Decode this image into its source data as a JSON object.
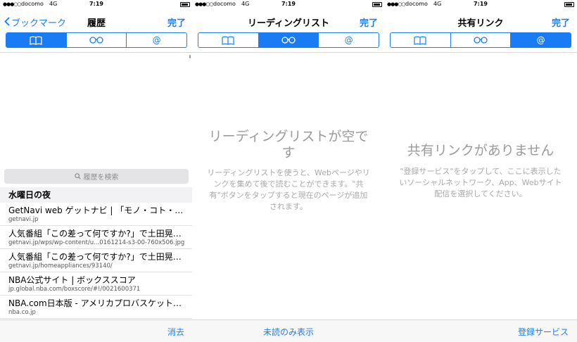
{
  "status_bar": {
    "signal": "●●●○○",
    "carrier": "docomo",
    "network": "4G",
    "time": "7:19"
  },
  "history_panel": {
    "back_label": "ブックマーク",
    "title": "履歴",
    "done_label": "完了",
    "search_placeholder": "履歴を検索",
    "section_header": "水曜日の夜",
    "items": [
      {
        "title": "GetNavi web ゲットナビ | 「モノ・コト・暮らし」の",
        "url": "getnavi.jp"
      },
      {
        "title": "人気番組「この差って何ですか?」で土田晃之が...",
        "url": "getnavi.jp/wps/wp-content/u...0161214-s3-00-760x506.jpg"
      },
      {
        "title": "人気番組「この差って何ですか?」で土田晃之が...",
        "url": "getnavi.jp/homeappliances/93140/"
      },
      {
        "title": "NBA公式サイト | ボックススコア",
        "url": "jp.global.nba.com/boxscore/#!/0021600371"
      },
      {
        "title": "NBA.com日本版 - アメリカプロバスケットボール",
        "url": "nba.co.jp"
      }
    ],
    "toolbar_label": "消去"
  },
  "reading_panel": {
    "title": "リーディングリスト",
    "done_label": "完了",
    "empty_title": "リーディングリストが空です",
    "empty_body": "リーディングリストを使うと、Webページやリンクを集めて後で読むことができます。\"共有\"ボタンをタップすると現在のページが追加されます。",
    "toolbar_label": "未読のみ表示"
  },
  "shared_panel": {
    "title": "共有リンク",
    "done_label": "完了",
    "empty_title": "共有リンクがありません",
    "empty_body": "\"登録サービス\"をタップして、ここに表示したいソーシャルネットワーク、App、Webサイト配信を選択してください。",
    "toolbar_label": "登録サービス"
  },
  "segments": {
    "bookmarks_icon": "book-icon",
    "reading_icon": "glasses-icon",
    "shared_icon": "at-icon",
    "at_glyph": "@"
  },
  "colors": {
    "accent": "#1a7cf5",
    "empty_text": "#9a9a9a"
  }
}
